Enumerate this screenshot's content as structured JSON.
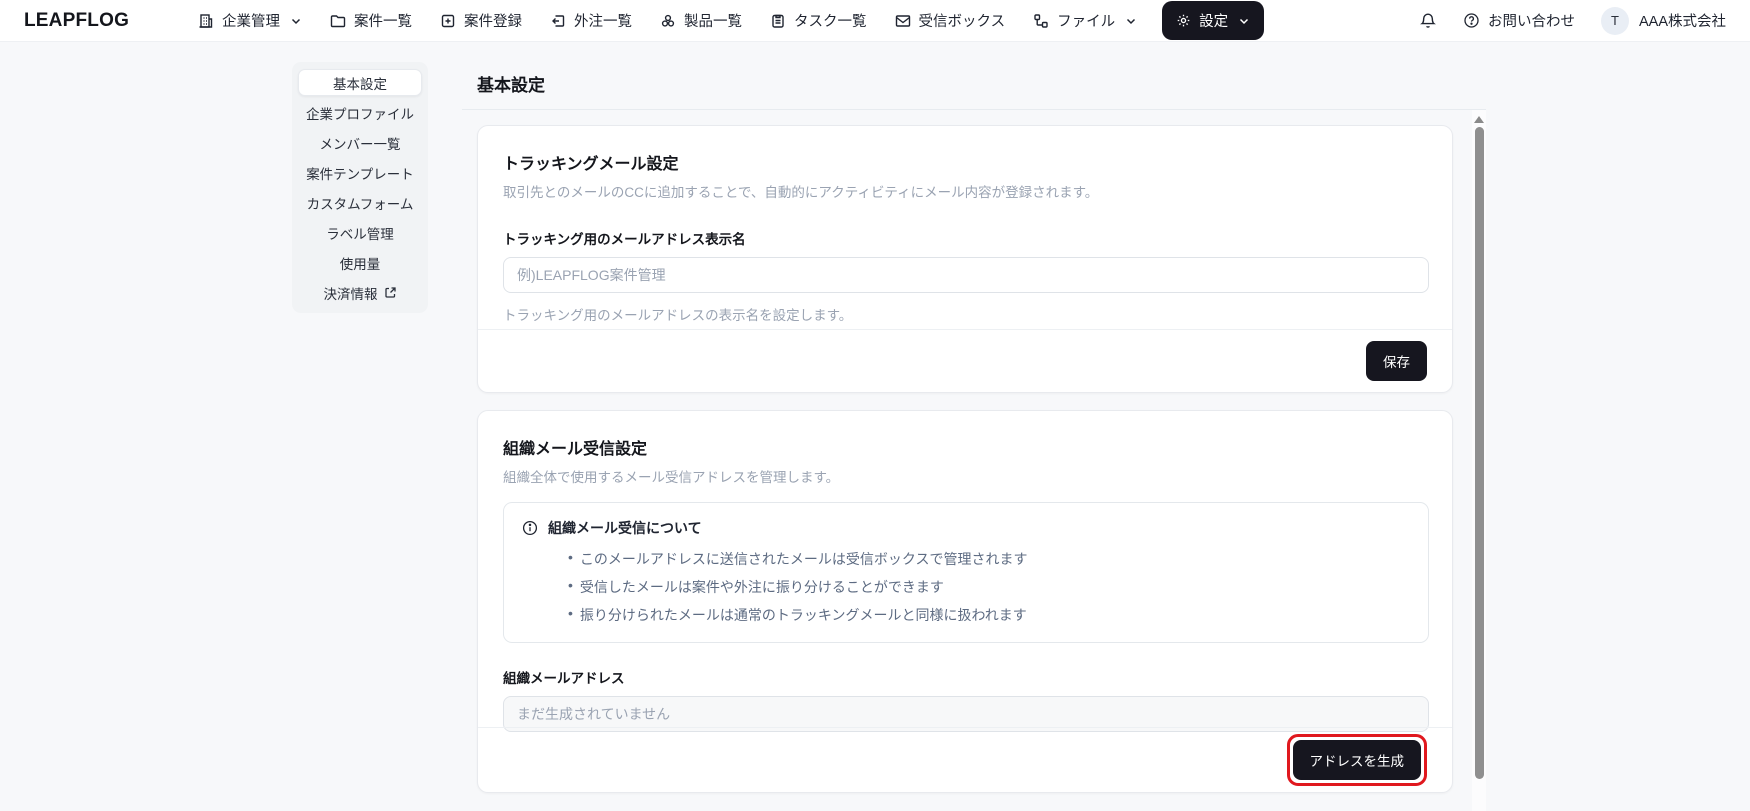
{
  "nav": {
    "logo": "LEAPFLOG",
    "items": [
      {
        "label": "企業管理",
        "icon": "building-icon",
        "has_dropdown": true
      },
      {
        "label": "案件一覧",
        "icon": "folder-icon",
        "has_dropdown": false
      },
      {
        "label": "案件登録",
        "icon": "file-plus-icon",
        "has_dropdown": false
      },
      {
        "label": "外注一覧",
        "icon": "outsource-icon",
        "has_dropdown": false
      },
      {
        "label": "製品一覧",
        "icon": "products-icon",
        "has_dropdown": false
      },
      {
        "label": "タスク一覧",
        "icon": "clipboard-icon",
        "has_dropdown": false
      },
      {
        "label": "受信ボックス",
        "icon": "mail-icon",
        "has_dropdown": false
      },
      {
        "label": "ファイル",
        "icon": "file-tree-icon",
        "has_dropdown": true
      }
    ],
    "settings_button": {
      "label": "設定",
      "icon": "gear-icon",
      "has_dropdown": true
    },
    "contact_label": "お問い合わせ",
    "account": {
      "avatar_initial": "T",
      "company_name": "AAA株式会社"
    }
  },
  "sidebar": {
    "items": [
      {
        "label": "基本設定",
        "active": true
      },
      {
        "label": "企業プロファイル",
        "active": false
      },
      {
        "label": "メンバー一覧",
        "active": false
      },
      {
        "label": "案件テンプレート",
        "active": false
      },
      {
        "label": "カスタムフォーム",
        "active": false
      },
      {
        "label": "ラベル管理",
        "active": false
      },
      {
        "label": "使用量",
        "active": false
      },
      {
        "label": "決済情報",
        "active": false,
        "external_link": true
      }
    ]
  },
  "main": {
    "page_title": "基本設定",
    "tracking_card": {
      "title": "トラッキングメール設定",
      "description": "取引先とのメールのCCに追加することで、自動的にアクティビティにメール内容が登録されます。",
      "field_label": "トラッキング用のメールアドレス表示名",
      "field_placeholder": "例)LEAPFLOG案件管理",
      "field_value": "",
      "field_help": "トラッキング用のメールアドレスの表示名を設定します。",
      "save_label": "保存"
    },
    "org_mail_card": {
      "title": "組織メール受信設定",
      "description": "組織全体で使用するメール受信アドレスを管理します。",
      "info_title": "組織メール受信について",
      "info_bullets": [
        "このメールアドレスに送信されたメールは受信ボックスで管理されます",
        "受信したメールは案件や外注に振り分けることができます",
        "振り分けられたメールは通常のトラッキングメールと同様に扱われます"
      ],
      "address_label": "組織メールアドレス",
      "address_placeholder": "まだ生成されていません",
      "generate_label": "アドレスを生成"
    }
  },
  "colors": {
    "accent_dark": "#16161f",
    "highlight_red": "#e0181e",
    "muted_text": "#9aa3b2",
    "info_text": "#5d6b82",
    "sidebar_bg": "#f1f3f5"
  }
}
